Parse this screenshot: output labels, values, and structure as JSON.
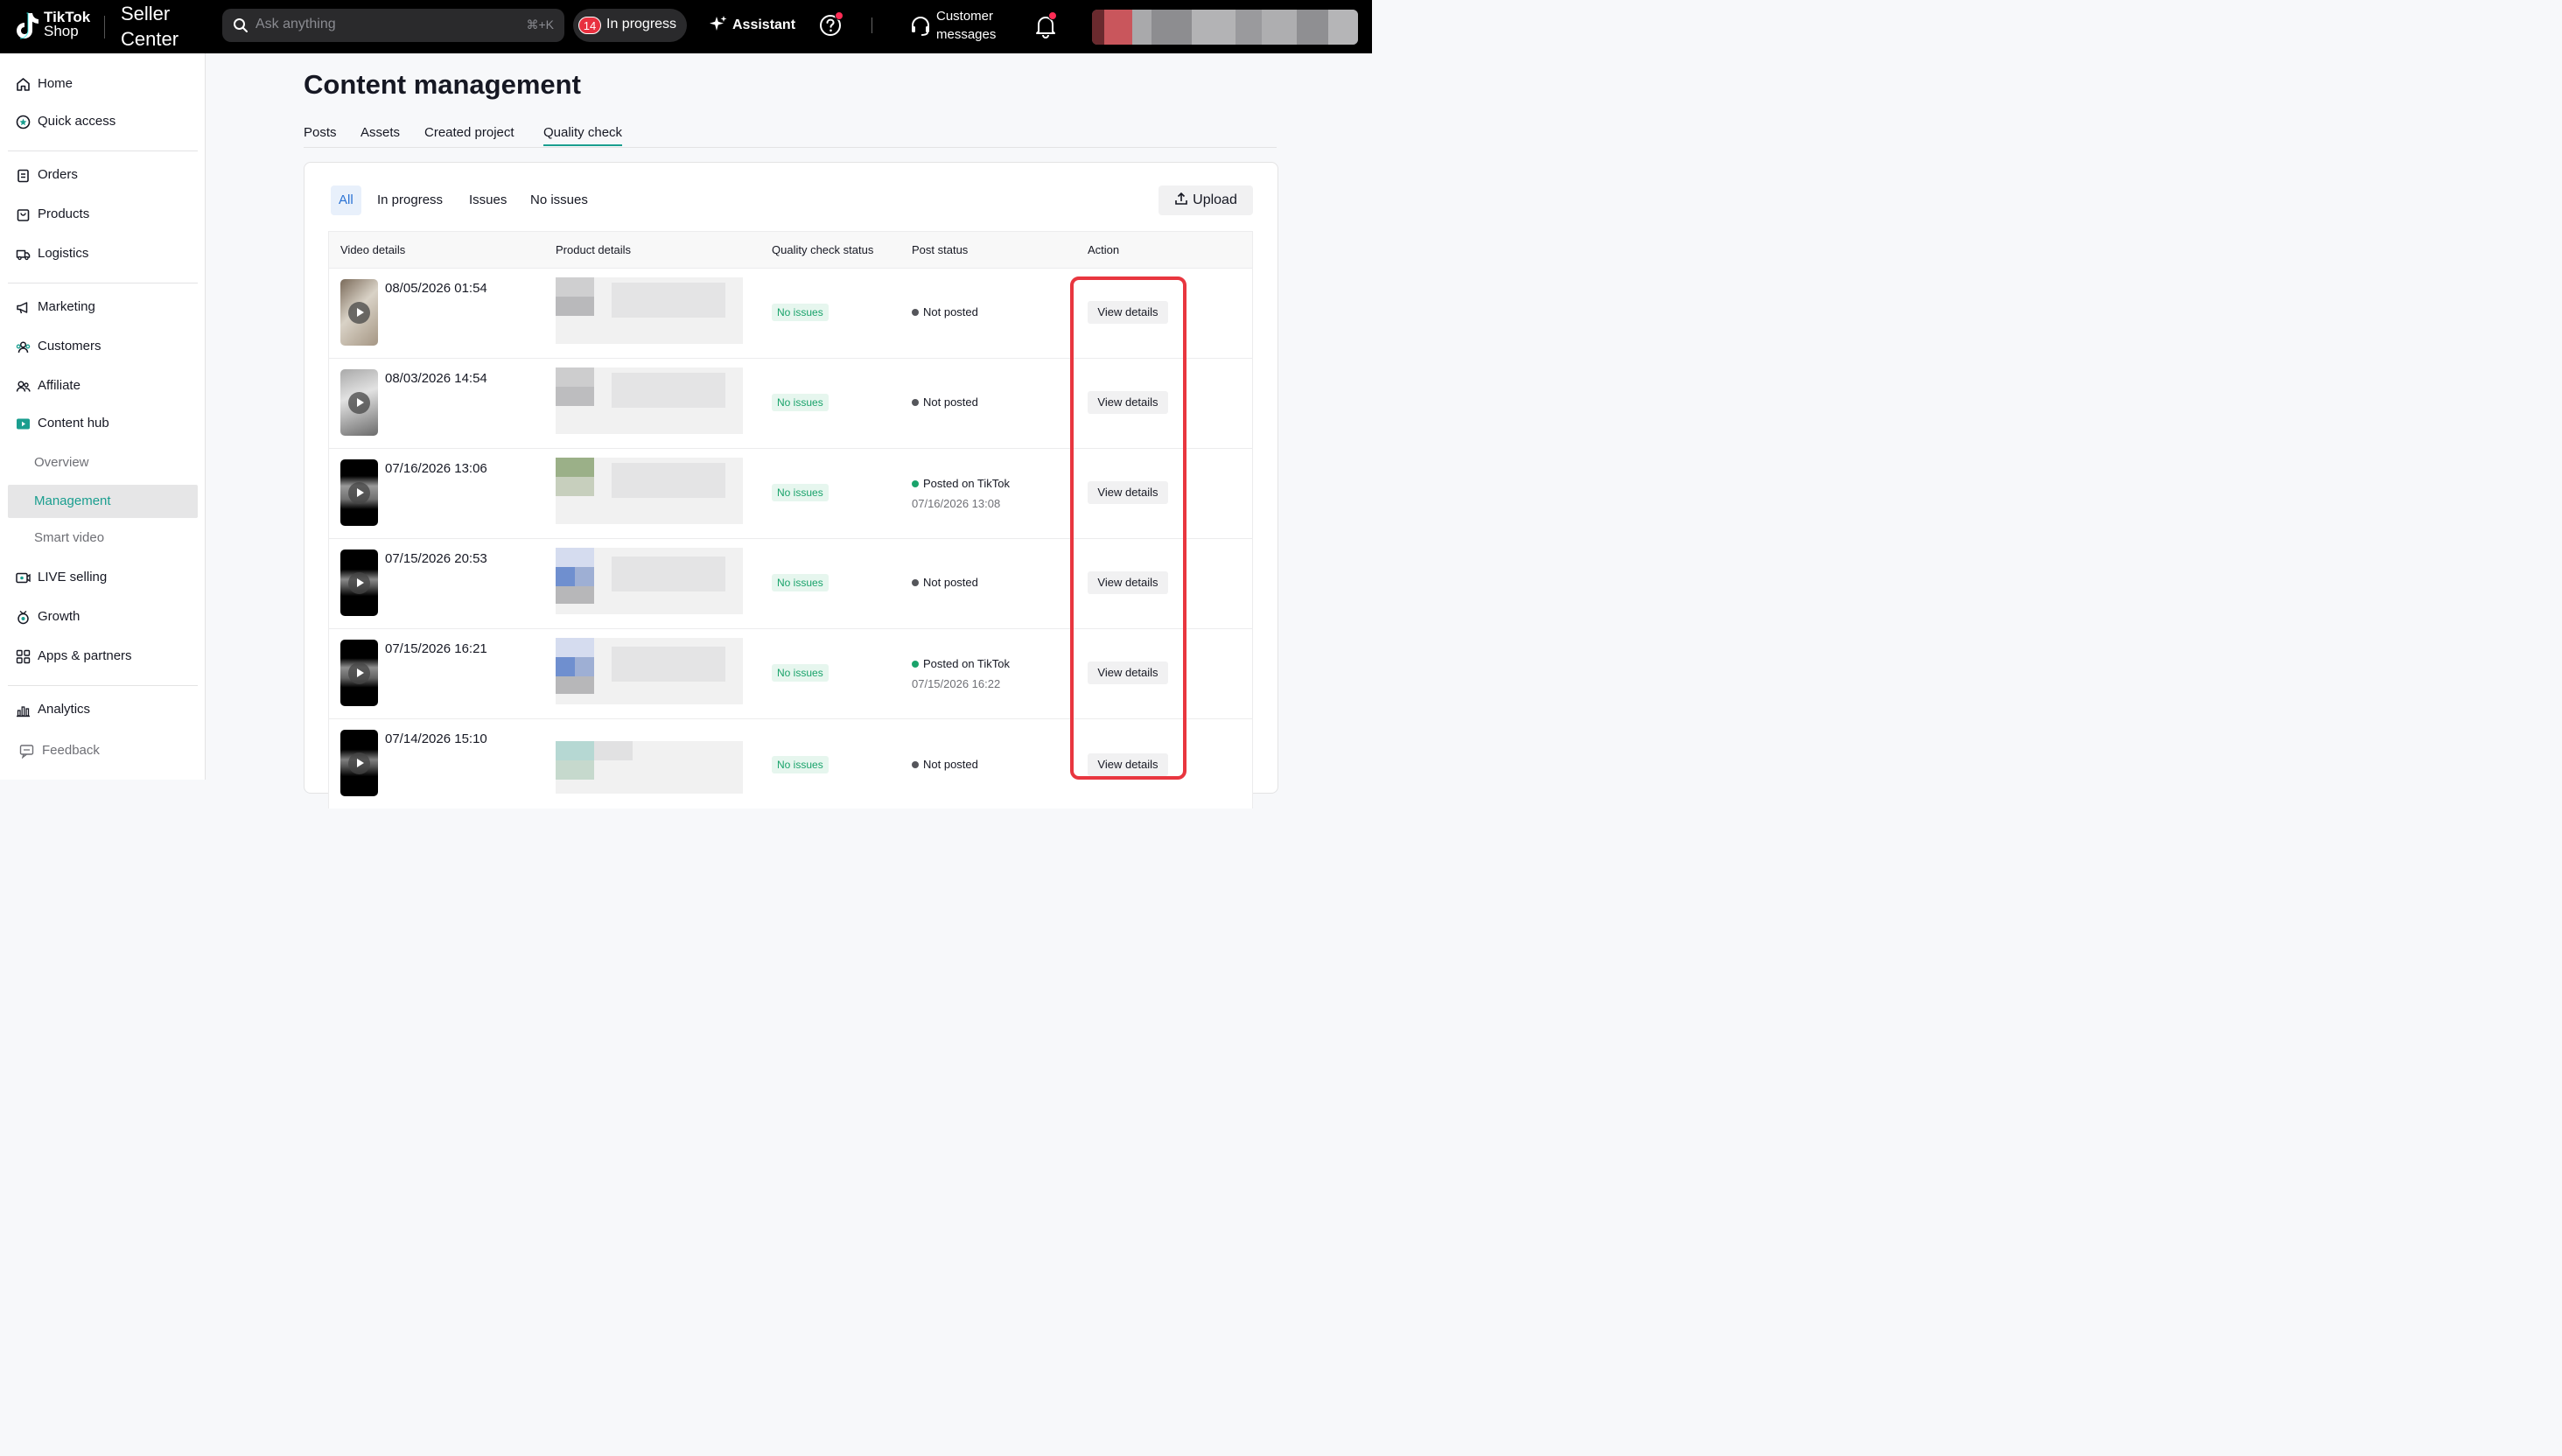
{
  "topbar": {
    "logo_line1": "TikTok",
    "logo_line2": "Shop",
    "brand_line1": "Seller",
    "brand_line2": "Center",
    "search_placeholder": "Ask anything",
    "search_shortcut": "⌘+K",
    "in_progress_count": "14",
    "in_progress_label": "In progress",
    "assistant_label": "Assistant",
    "customer_messages_line1": "Customer",
    "customer_messages_line2": "messages",
    "icons": [
      "search-icon",
      "sparkle-icon",
      "help-icon",
      "headset-icon",
      "bell-icon"
    ]
  },
  "sidebar": {
    "items": [
      {
        "label": "Home",
        "icon": "home-icon"
      },
      {
        "label": "Quick access",
        "icon": "star-circle-icon"
      },
      {
        "label": "Orders",
        "icon": "clipboard-icon"
      },
      {
        "label": "Products",
        "icon": "bag-icon"
      },
      {
        "label": "Logistics",
        "icon": "truck-icon"
      },
      {
        "label": "Marketing",
        "icon": "megaphone-icon"
      },
      {
        "label": "Customers",
        "icon": "users-icon"
      },
      {
        "label": "Affiliate",
        "icon": "affiliate-icon"
      },
      {
        "label": "Content hub",
        "icon": "video-icon"
      },
      {
        "label": "Overview"
      },
      {
        "label": "Management"
      },
      {
        "label": "Smart video"
      },
      {
        "label": "LIVE selling",
        "icon": "live-icon"
      },
      {
        "label": "Growth",
        "icon": "growth-icon"
      },
      {
        "label": "Apps & partners",
        "icon": "apps-icon"
      },
      {
        "label": "Analytics",
        "icon": "chart-icon"
      },
      {
        "label": "Feedback",
        "icon": "feedback-icon"
      }
    ],
    "active_item": "Management"
  },
  "main": {
    "title": "Content management",
    "tabs": [
      "Posts",
      "Assets",
      "Created project",
      "Quality check"
    ],
    "active_tab": "Quality check",
    "filters": [
      "All",
      "In progress",
      "Issues",
      "No issues"
    ],
    "active_filter": "All",
    "upload_label": "Upload",
    "table": {
      "columns": [
        "Video details",
        "Product details",
        "Quality check status",
        "Post status",
        "Action"
      ],
      "rows": [
        {
          "date": "08/05/2026 01:54",
          "qc": "No issues",
          "post": "Not posted",
          "post_date": "",
          "action": "View details"
        },
        {
          "date": "08/03/2026 14:54",
          "qc": "No issues",
          "post": "Not posted",
          "post_date": "",
          "action": "View details"
        },
        {
          "date": "07/16/2026 13:06",
          "qc": "No issues",
          "post": "Posted on TikTok",
          "post_date": "07/16/2026 13:08",
          "action": "View details"
        },
        {
          "date": "07/15/2026 20:53",
          "qc": "No issues",
          "post": "Not posted",
          "post_date": "",
          "action": "View details"
        },
        {
          "date": "07/15/2026 16:21",
          "qc": "No issues",
          "post": "Posted on TikTok",
          "post_date": "07/15/2026 16:22",
          "action": "View details"
        },
        {
          "date": "07/14/2026 15:10",
          "qc": "No issues",
          "post": "Not posted",
          "post_date": "",
          "action": "View details"
        }
      ]
    }
  },
  "colors": {
    "accent": "#1a9e8f",
    "highlight": "#e8363f",
    "badge_red": "#e8303f",
    "status_green": "#1aa36b",
    "filter_blue": "#2a72d4"
  }
}
